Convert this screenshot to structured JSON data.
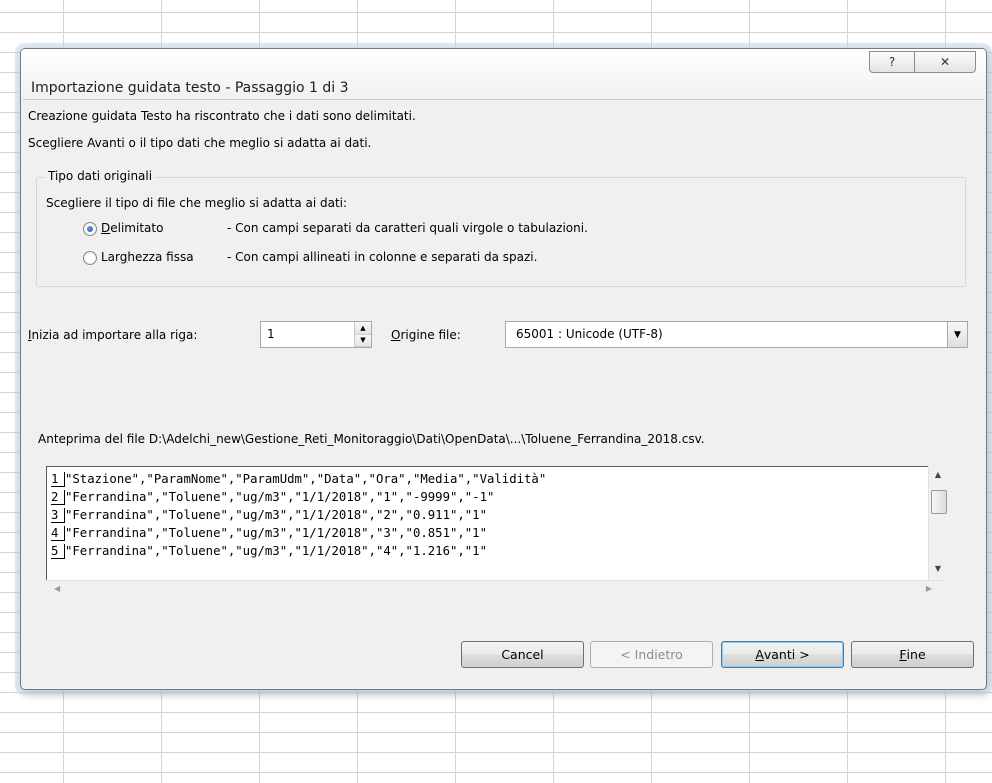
{
  "dialog": {
    "title": "Importazione guidata testo - Passaggio 1 di 3",
    "help_glyph": "?",
    "close_glyph": "✕"
  },
  "intro": {
    "line1": "Creazione guidata Testo ha riscontrato che i dati sono delimitati.",
    "line2": "Scegliere Avanti o il tipo dati che meglio si adatta ai dati."
  },
  "data_type_group": {
    "legend": "Tipo dati originali",
    "prompt": "Scegliere il tipo di file che meglio si adatta ai dati:",
    "options": [
      {
        "label_pre": "",
        "label_accel": "D",
        "label_post": "elimitato",
        "description": "- Con campi separati da caratteri quali virgole o tabulazioni.",
        "selected": true
      },
      {
        "label_pre": "Lar",
        "label_accel": "g",
        "label_post": "hezza fissa",
        "description": "- Con campi allineati in colonne e separati da spazi.",
        "selected": false
      }
    ]
  },
  "start_row": {
    "label_accel": "I",
    "label_rest": "nizia ad importare alla riga:",
    "value": "1"
  },
  "file_origin": {
    "label_accel": "O",
    "label_rest": "rigine file:",
    "value": "65001 : Unicode (UTF-8)"
  },
  "preview": {
    "label": "Anteprima del file D:\\Adelchi_new\\Gestione_Reti_Monitoraggio\\Dati\\OpenData\\...\\Toluene_Ferrandina_2018.csv.",
    "rows": [
      {
        "num": "1",
        "text": "\"Stazione\",\"ParamNome\",\"ParamUdm\",\"Data\",\"Ora\",\"Media\",\"Validità\""
      },
      {
        "num": "2",
        "text": "\"Ferrandina\",\"Toluene\",\"ug/m3\",\"1/1/2018\",\"1\",\"-9999\",\"-1\""
      },
      {
        "num": "3",
        "text": "\"Ferrandina\",\"Toluene\",\"ug/m3\",\"1/1/2018\",\"2\",\"0.911\",\"1\""
      },
      {
        "num": "4",
        "text": "\"Ferrandina\",\"Toluene\",\"ug/m3\",\"1/1/2018\",\"3\",\"0.851\",\"1\""
      },
      {
        "num": "5",
        "text": "\"Ferrandina\",\"Toluene\",\"ug/m3\",\"1/1/2018\",\"4\",\"1.216\",\"1\""
      }
    ]
  },
  "buttons": {
    "cancel": "Cancel",
    "back": "< Indietro",
    "next_accel": "A",
    "next_rest": "vanti >",
    "finish_accel": "F",
    "finish_rest": "ine"
  }
}
